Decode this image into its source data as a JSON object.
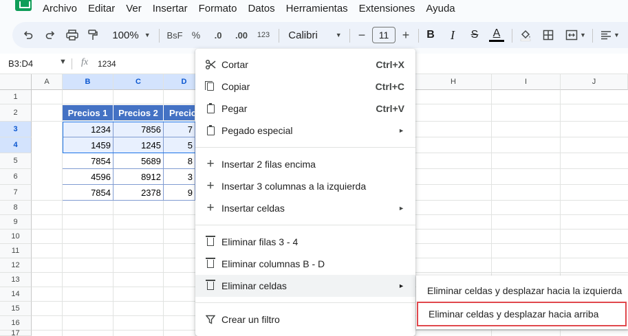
{
  "menu": {
    "items": [
      "Archivo",
      "Editar",
      "Ver",
      "Insertar",
      "Formato",
      "Datos",
      "Herramientas",
      "Extensiones",
      "Ayuda"
    ]
  },
  "toolbar": {
    "zoom": "100%",
    "currency_format": "BsF",
    "percent_format": "%",
    "decrease_decimals": ".0",
    "increase_decimals": ".00",
    "more_formats": "123",
    "font_family": "Calibri",
    "font_size": "11",
    "bold": "B",
    "italic": "I",
    "strikethrough": "S",
    "text_color": "A"
  },
  "formula_bar": {
    "name_box": "B3:D4",
    "fx": "fx",
    "value": "1234"
  },
  "grid": {
    "columns": [
      "A",
      "B",
      "C",
      "D",
      "H",
      "I",
      "J"
    ],
    "rows": [
      "1",
      "2",
      "3",
      "4",
      "5",
      "6",
      "7",
      "8",
      "9",
      "10",
      "11",
      "12",
      "13",
      "14",
      "15",
      "16",
      "17"
    ],
    "table_headers": [
      "Precios 1",
      "Precios 2",
      "Precio"
    ],
    "table_rows": [
      [
        "1234",
        "7856",
        "7"
      ],
      [
        "1459",
        "1245",
        "5"
      ],
      [
        "7854",
        "5689",
        "8"
      ],
      [
        "4596",
        "8912",
        "3"
      ],
      [
        "7854",
        "2378",
        "9"
      ]
    ]
  },
  "context_menu": {
    "items": [
      {
        "label": "Cortar",
        "shortcut": "Ctrl+X",
        "icon": "scissors-icon"
      },
      {
        "label": "Copiar",
        "shortcut": "Ctrl+C",
        "icon": "copy-icon"
      },
      {
        "label": "Pegar",
        "shortcut": "Ctrl+V",
        "icon": "paste-icon"
      },
      {
        "label": "Pegado especial",
        "icon": "paste-special-icon"
      },
      {
        "label": "Insertar 2 filas encima",
        "icon": "plus-icon"
      },
      {
        "label": "Insertar 3 columnas a la izquierda",
        "icon": "plus-icon"
      },
      {
        "label": "Insertar celdas",
        "icon": "plus-icon"
      },
      {
        "label": "Eliminar filas 3 - 4",
        "icon": "trash-icon"
      },
      {
        "label": "Eliminar columnas B - D",
        "icon": "trash-icon"
      },
      {
        "label": "Eliminar celdas",
        "icon": "trash-icon"
      },
      {
        "label": "Crear un filtro",
        "icon": "filter-icon"
      }
    ]
  },
  "submenu": {
    "items": [
      "Eliminar celdas y desplazar hacia la izquierda",
      "Eliminar celdas y desplazar hacia arriba"
    ]
  },
  "colors": {
    "table_header_bg": "#4472c4",
    "selection_accent": "#1a73e8",
    "highlight_border": "#e0474c"
  }
}
